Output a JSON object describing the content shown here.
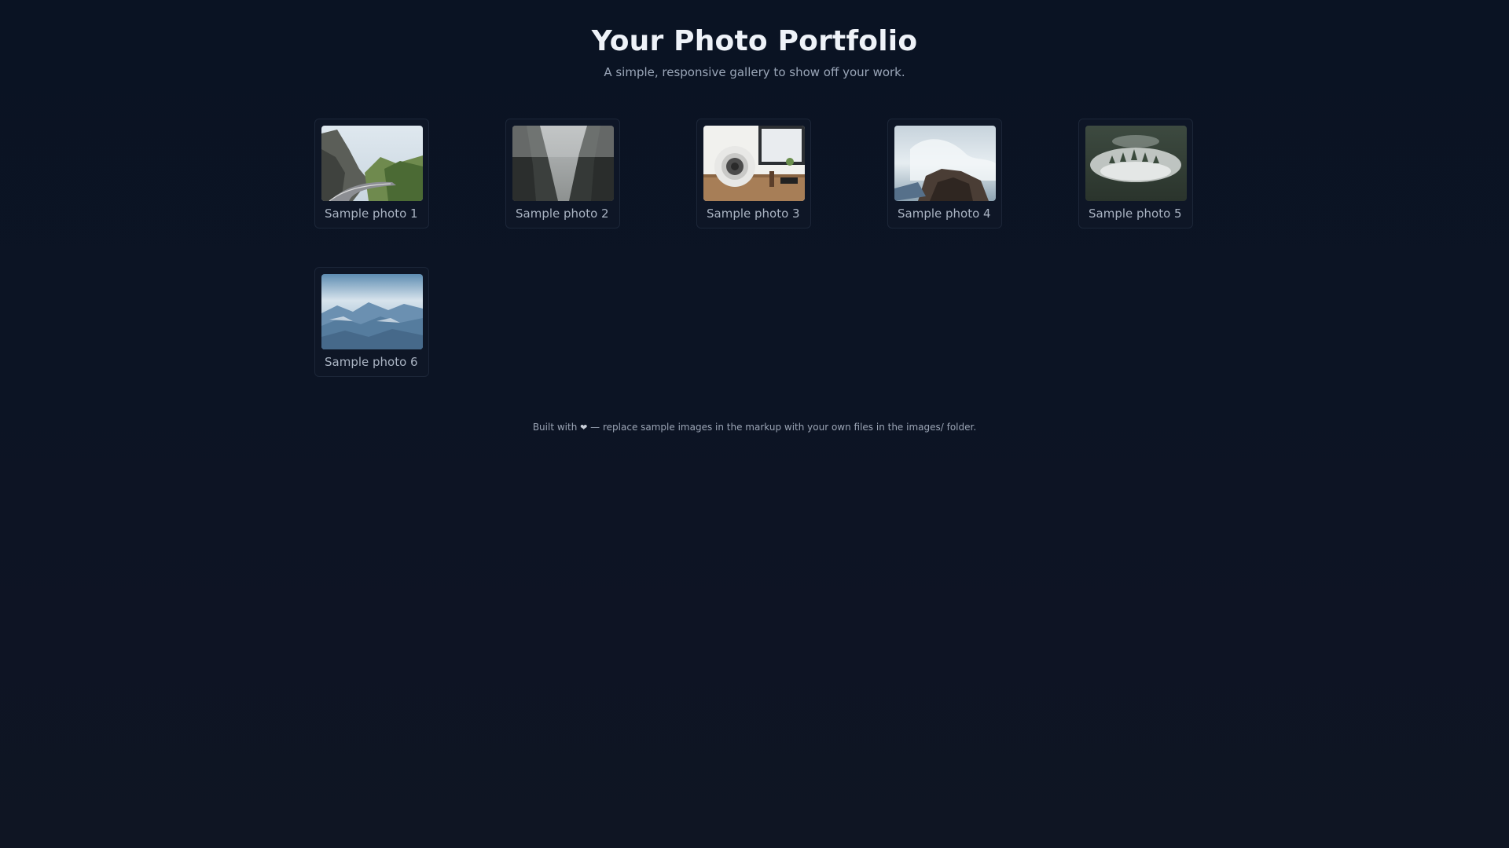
{
  "header": {
    "title": "Your Photo Portfolio",
    "subtitle": "A simple, responsive gallery to show off your work."
  },
  "gallery": {
    "items": [
      {
        "caption": "Sample photo 1",
        "icon": "mountain-road-photo"
      },
      {
        "caption": "Sample photo 2",
        "icon": "foggy-canyon-photo"
      },
      {
        "caption": "Sample photo 3",
        "icon": "desk-speaker-photo"
      },
      {
        "caption": "Sample photo 4",
        "icon": "ocean-wave-rock-photo"
      },
      {
        "caption": "Sample photo 5",
        "icon": "misty-forest-photo"
      },
      {
        "caption": "Sample photo 6",
        "icon": "aerial-mountains-photo"
      }
    ]
  },
  "footer": {
    "prefix": "Built with",
    "heart": "❤",
    "suffix": "— replace sample images in the markup with your own files in the images/ folder."
  },
  "colors": {
    "background": "#0b1322",
    "card_border": "#1c2638",
    "title": "#eef2f8",
    "muted_text": "#9aa6b8"
  }
}
